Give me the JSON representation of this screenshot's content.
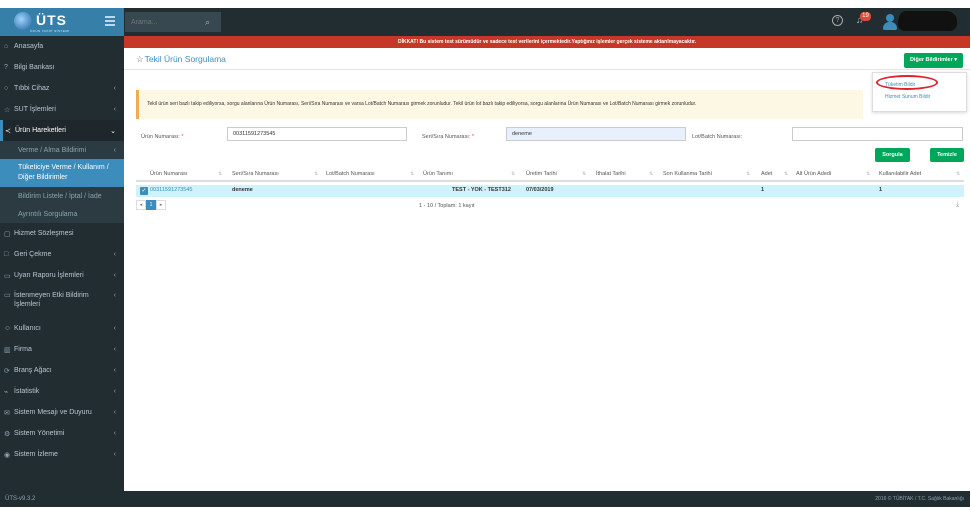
{
  "header": {
    "logo_text": "ÜTS",
    "logo_subtitle": "ÜRÜN TAKİP SİSTEMİ",
    "search_placeholder": "Arama...",
    "notification_count": "19"
  },
  "sidebar": {
    "items": [
      {
        "label": "Anasayfa",
        "icon": "home-icon"
      },
      {
        "label": "Bilgi Bankası",
        "icon": "question-icon"
      },
      {
        "label": "Tıbbi Cihaz",
        "icon": "circle-icon"
      },
      {
        "label": "SUT İşlemleri",
        "icon": "star-icon"
      },
      {
        "label": "Ürün Hareketleri",
        "icon": "share-icon"
      }
    ],
    "sub_items": [
      {
        "label": "Verme / Alma Bildirimi"
      },
      {
        "label": "Tüketiciye Verme / Kullanım / Diğer Bildirimler"
      },
      {
        "label": "Bildirim Listele / İptal / İade"
      },
      {
        "label": "Ayrıntılı Sorgulama"
      }
    ],
    "items_after": [
      {
        "label": "Hizmet Sözleşmesi",
        "icon": "file-icon"
      },
      {
        "label": "Geri Çekme",
        "icon": "square-icon"
      },
      {
        "label": "Uyarı Raporu İşlemleri",
        "icon": "comment-icon"
      },
      {
        "label": "İstenmeyen Etki Bildirim İşlemleri",
        "icon": "comment-icon"
      },
      {
        "label": "Kullanıcı",
        "icon": "user-icon"
      },
      {
        "label": "Firma",
        "icon": "building-icon"
      },
      {
        "label": "Branş Ağacı",
        "icon": "tree-icon"
      },
      {
        "label": "İstatistik",
        "icon": "chart-icon"
      },
      {
        "label": "Sistem Mesajı ve Duyuru",
        "icon": "envelope-icon"
      },
      {
        "label": "Sistem Yönetimi",
        "icon": "gear-icon"
      },
      {
        "label": "Sistem İzleme",
        "icon": "eye-icon"
      }
    ],
    "version": "ÜTS-v9.3.2"
  },
  "warning_bar": "DİKKAT! Bu sistem test sürümüdür ve sadece test verilerini içermektedir.Yaptığınız işlemler gerçek sisteme aktarılmayacaktır.",
  "page": {
    "title": "Tekil Ürün Sorgulama",
    "notifications_button": "Diğer Bildirimler ▾",
    "dropdown": [
      "Tüketim Bildir",
      "Hizmet Sunum Bildir"
    ],
    "callout": "Tekil ürün seri bazlı takip ediliyorsa, sorgu alanlarına Ürün Numarası, Seri/Sıra Numarası ve varsa Lot/Batch Numarası girmek zorunludur. Tekil ürün lot bazlı takip ediliyorsa, sorgu alanlarına Ürün Numarası ve Lot/Batch Numarası girmek zorunludur."
  },
  "form": {
    "product_no_label": "Ürün Numarası:",
    "product_no_value": "00311591273545",
    "serial_no_label": "Seri/Sıra Numarası:",
    "serial_no_value": "deneme",
    "lot_no_label": "Lot/Batch Numarası:",
    "lot_no_value": "",
    "required_mark": "*",
    "query_button": "Sorgula",
    "clear_button": "Temizle"
  },
  "table": {
    "columns": [
      "Ürün Numarası",
      "Seri/Sıra Numarası",
      "Lot/Batch Numarası",
      "Ürün Tanımı",
      "Üretim Tarihi",
      "İthalat Tarihi",
      "Son Kullanma Tarihi",
      "Adet",
      "Alt Ürün Adedi",
      "Kullanılabilir Adet"
    ],
    "rows": [
      [
        "00311591273545",
        "deneme",
        "",
        "TEST - YOK - TEST312",
        "07/03/2019",
        "",
        "",
        "1",
        "",
        "1"
      ]
    ],
    "pager_info": "1 - 10 / Toplam: 1 kayıt",
    "current_page": "1"
  },
  "footer": "2016 © TÜBİTAK / T.C. Sağlık Bakanlığı"
}
